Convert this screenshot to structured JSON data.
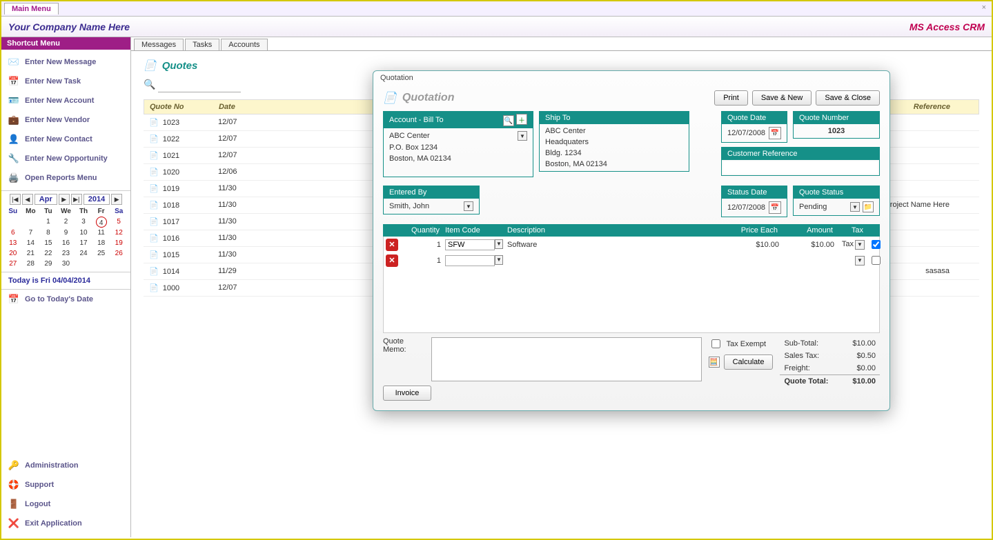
{
  "top": {
    "main_menu": "Main Menu",
    "close": "×"
  },
  "header": {
    "company": "Your Company Name Here",
    "app": "MS Access CRM"
  },
  "sidebar": {
    "title": "Shortcut Menu",
    "items": [
      {
        "icon": "✉️",
        "label": "Enter New Message"
      },
      {
        "icon": "📅",
        "label": "Enter New Task"
      },
      {
        "icon": "🪪",
        "label": "Enter New Account"
      },
      {
        "icon": "💼",
        "label": "Enter New Vendor"
      },
      {
        "icon": "👤",
        "label": "Enter New Contact"
      },
      {
        "icon": "🔧",
        "label": "Enter New Opportunity"
      },
      {
        "icon": "🖨️",
        "label": "Open Reports Menu"
      }
    ],
    "cal": {
      "month": "Apr",
      "year": "2014",
      "heads": [
        "Su",
        "Mo",
        "Tu",
        "We",
        "Th",
        "Fr",
        "Sa"
      ],
      "days": [
        [
          "",
          "",
          "1",
          "2",
          "3",
          "4",
          "5"
        ],
        [
          "6",
          "7",
          "8",
          "9",
          "10",
          "11",
          "12"
        ],
        [
          "13",
          "14",
          "15",
          "16",
          "17",
          "18",
          "19"
        ],
        [
          "20",
          "21",
          "22",
          "23",
          "24",
          "25",
          "26"
        ],
        [
          "27",
          "28",
          "29",
          "30",
          "",
          "",
          ""
        ]
      ],
      "today_col": 5,
      "today_row": 0
    },
    "today_line": "Today is Fri 04/04/2014",
    "goto": {
      "icon": "📅",
      "label": "Go to Today's Date"
    },
    "bottom": [
      {
        "icon": "🔑",
        "label": "Administration"
      },
      {
        "icon": "🛟",
        "label": "Support"
      },
      {
        "icon": "🚪",
        "label": "Logout"
      },
      {
        "icon": "❌",
        "label": "Exit Application"
      }
    ]
  },
  "tabstrip": [
    "Messages",
    "Tasks",
    "Accounts"
  ],
  "quotes_panel": {
    "icon": "📄",
    "title": "Quotes",
    "search_ph": ""
  },
  "quotes_head": {
    "no": "Quote No",
    "date": "Date",
    "ref": "Reference"
  },
  "quotes": [
    {
      "no": "1023",
      "date": "12/07",
      "ref": ""
    },
    {
      "no": "1022",
      "date": "12/07",
      "ref": ""
    },
    {
      "no": "1021",
      "date": "12/07",
      "ref": ""
    },
    {
      "no": "1020",
      "date": "12/06",
      "ref": ""
    },
    {
      "no": "1019",
      "date": "11/30",
      "ref": ""
    },
    {
      "no": "1018",
      "date": "11/30",
      "ref": "Project Name Here"
    },
    {
      "no": "1017",
      "date": "11/30",
      "ref": ""
    },
    {
      "no": "1016",
      "date": "11/30",
      "ref": ""
    },
    {
      "no": "1015",
      "date": "11/30",
      "ref": ""
    },
    {
      "no": "1014",
      "date": "11/29",
      "ref": "sasasa"
    },
    {
      "no": "1000",
      "date": "12/07",
      "ref": ""
    }
  ],
  "modal": {
    "window_title": "Quotation",
    "title": "Quotation",
    "buttons": {
      "print": "Print",
      "save_new": "Save & New",
      "save_close": "Save & Close"
    },
    "account": {
      "header": "Account - Bill To",
      "name": "ABC Center",
      "line1": "P.O. Box 1234",
      "line2": "Boston, MA  02134"
    },
    "ship": {
      "header": "Ship To",
      "name": "ABC Center",
      "line1": "Headquaters",
      "line2": "Bldg. 1234",
      "line3": "Boston, MA  02134"
    },
    "quote_date": {
      "header": "Quote Date",
      "value": "12/07/2008"
    },
    "quote_number": {
      "header": "Quote Number",
      "value": "1023"
    },
    "cust_ref": {
      "header": "Customer Reference",
      "value": ""
    },
    "entered_by": {
      "header": "Entered By",
      "value": "Smith, John"
    },
    "status_date": {
      "header": "Status Date",
      "value": "12/07/2008"
    },
    "quote_status": {
      "header": "Quote Status",
      "value": "Pending"
    },
    "items_head": {
      "qty": "Quantity",
      "code": "Item Code",
      "desc": "Description",
      "price": "Price Each",
      "amount": "Amount",
      "tax": "Tax"
    },
    "items": [
      {
        "qty": "1",
        "code": "SFW",
        "desc": "Software",
        "price": "$10.00",
        "amount": "$10.00",
        "tax": "Tax",
        "checked": true
      },
      {
        "qty": "1",
        "code": "",
        "desc": "",
        "price": "",
        "amount": "",
        "tax": "",
        "checked": false
      }
    ],
    "memo_label": "Quote Memo:",
    "memo": "",
    "tax_exempt_label": "Tax Exempt",
    "calculate": "Calculate",
    "invoice": "Invoice",
    "totals": {
      "subtotal_l": "Sub-Total:",
      "subtotal": "$10.00",
      "tax_l": "Sales Tax:",
      "tax": "$0.50",
      "freight_l": "Freight:",
      "freight": "$0.00",
      "total_l": "Quote Total:",
      "total": "$10.00"
    }
  }
}
